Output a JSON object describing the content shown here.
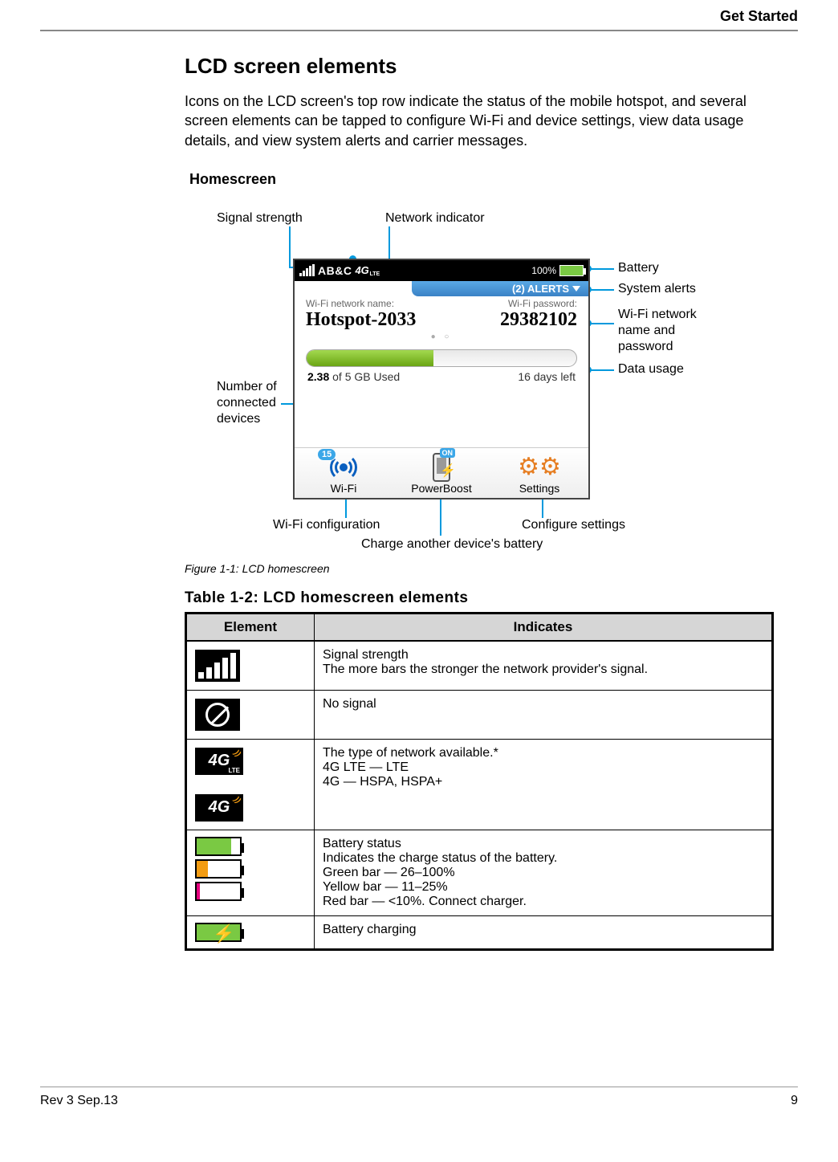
{
  "header": {
    "section": "Get Started"
  },
  "section": {
    "title": "LCD screen elements",
    "lead": "Icons on the LCD screen's top row indicate the status of the mobile hotspot, and several screen elements can be tapped to configure Wi-Fi and device settings, view data usage details, and view system alerts and carrier messages.",
    "subhead": "Homescreen"
  },
  "callouts": {
    "signal_strength": "Signal strength",
    "network_indicator": "Network indicator",
    "battery": "Battery",
    "system_alerts": "System alerts",
    "wifi_name_pw": "Wi-Fi network name and password",
    "data_usage": "Data usage",
    "connected_devices": "Number of connected devices",
    "wifi_config": "Wi-Fi configuration",
    "charge_device": "Charge another device's battery",
    "configure_settings": "Configure settings"
  },
  "device": {
    "carrier": "AB&C",
    "net_badge": "4G",
    "net_sub": "LTE",
    "battery_pct": "100%",
    "alerts_text": "(2) ALERTS",
    "wifi_name_label": "Wi-Fi network name:",
    "wifi_name_value": "Hotspot-2033",
    "wifi_pw_label": "Wi-Fi password:",
    "wifi_pw_value": "29382102",
    "usage_used_bold": "2.38",
    "usage_used_rest": " of 5 GB Used",
    "usage_days": "16 days left",
    "wifi_badge": "15",
    "tab_wifi": "Wi-Fi",
    "tab_power": "PowerBoost",
    "tab_settings": "Settings",
    "on_badge": "ON"
  },
  "figure_caption": "Figure 1-1:  LCD homescreen",
  "table": {
    "title": "Table 1-2:  LCD homescreen elements",
    "col_element": "Element",
    "col_indicates": "Indicates",
    "rows": {
      "signal": "Signal strength\nThe more bars the stronger the network provider's signal.",
      "nosignal": "No signal",
      "network": "The type of network available.*\n4G LTE — LTE\n4G — HSPA, HSPA+",
      "battery": "Battery status\nIndicates the charge status of the battery.\nGreen bar — 26–100%\nYellow bar — 11–25%\nRed bar — <10%. Connect charger.",
      "charging": "Battery charging"
    }
  },
  "footer": {
    "rev": "Rev 3  Sep.13",
    "page_no": "9"
  }
}
